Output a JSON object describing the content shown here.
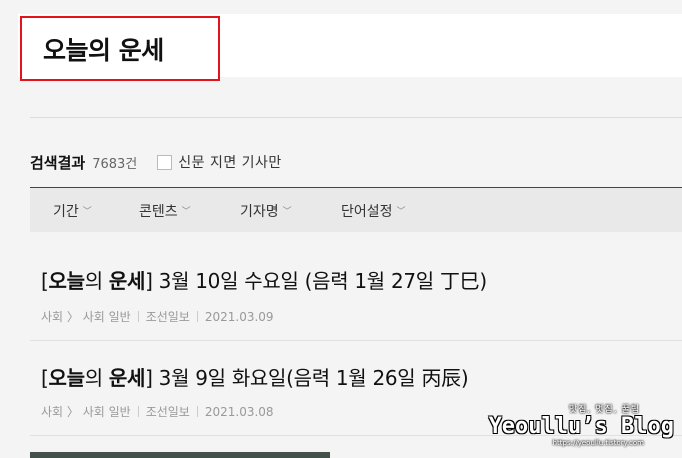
{
  "search": {
    "query": "오늘의 운세"
  },
  "results": {
    "title": "검색결과",
    "count": "7683건",
    "filter_checkbox_label": "신문 지면 기사만"
  },
  "filters": [
    {
      "label": "기간"
    },
    {
      "label": "콘텐츠"
    },
    {
      "label": "기자명"
    },
    {
      "label": "단어설정"
    }
  ],
  "articles": [
    {
      "title_prefix": "[",
      "title_kw1": "오늘",
      "title_mid": "의 ",
      "title_kw2": "운세",
      "title_rest": "] 3월 10일 수요일 (음력 1월 27일 丁巳)",
      "section": "사회 〉 사회 일반",
      "source": "조선일보",
      "date": "2021.03.09"
    },
    {
      "title_prefix": "[",
      "title_kw1": "오늘",
      "title_mid": "의 ",
      "title_kw2": "운세",
      "title_rest": "] 3월 9일 화요일(음력 1월 26일 丙辰)",
      "section": "사회 〉 사회 일반",
      "source": "조선일보",
      "date": "2021.03.08"
    }
  ],
  "watermark": {
    "tagline": "맛집, 멋집, 꿀팁",
    "blog_name": "Yeoullu’s Blog",
    "url": "https://yeoullu.tistory.com"
  },
  "colors": {
    "highlight_border": "#e3131b",
    "filter_bar_bg": "#e9e9e9"
  }
}
